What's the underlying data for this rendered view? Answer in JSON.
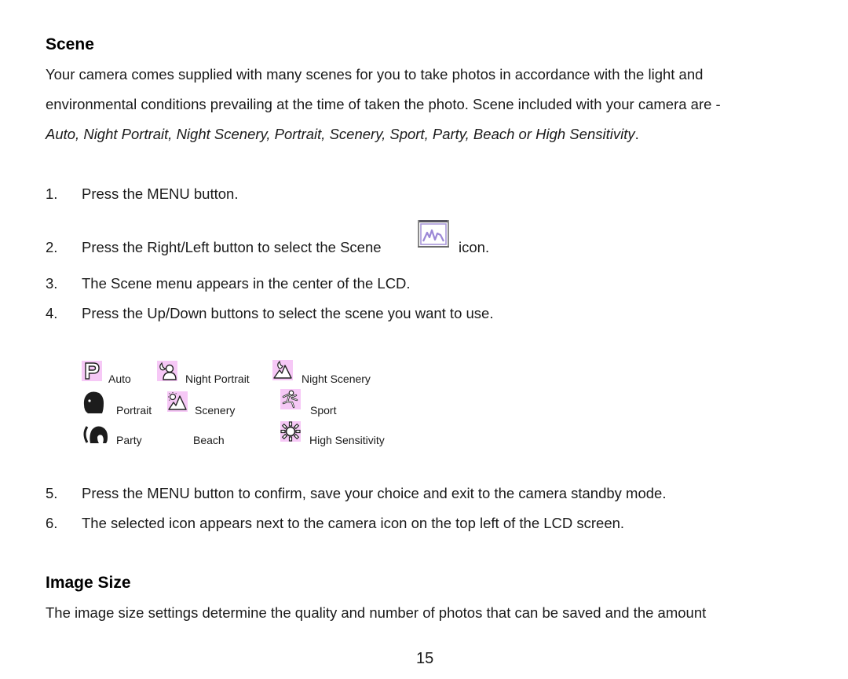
{
  "section1": {
    "heading": "Scene",
    "intro_lines": [
      "Your camera comes supplied with many scenes for you to take photos in accordance with the light and",
      "environmental conditions prevailing at the time of taken the photo. Scene included with your camera are -"
    ],
    "intro_italic": "Auto, Night Portrait, Night Scenery, Portrait, Scenery, Sport, Party, Beach or High Sensitivity",
    "intro_italic_end": ".",
    "steps": [
      {
        "num": "1.",
        "text": "Press the MENU button."
      },
      {
        "num": "2.",
        "text": "Press the Right/Left button to select the Scene",
        "text_after": "icon.",
        "icon": "scene-mode-icon"
      },
      {
        "num": "3.",
        "text": "The Scene menu appears in the center of the LCD."
      },
      {
        "num": "4.",
        "text": "Press the Up/Down buttons to select the scene you want to use."
      },
      {
        "num": "5.",
        "text": "Press the MENU button to confirm, save your choice and exit to the camera standby mode."
      },
      {
        "num": "6.",
        "text": "The selected icon appears next to the camera icon on the top left of the LCD screen."
      }
    ],
    "scene_icons": [
      {
        "label": "Auto",
        "icon": "auto-p-icon"
      },
      {
        "label": "Night Portrait",
        "icon": "night-portrait-icon"
      },
      {
        "label": "Night Scenery",
        "icon": "night-scenery-icon"
      },
      {
        "label": "Portrait",
        "icon": "portrait-icon"
      },
      {
        "label": "Scenery",
        "icon": "scenery-icon"
      },
      {
        "label": "Sport",
        "icon": "sport-icon"
      },
      {
        "label": "Party",
        "icon": "party-icon"
      },
      {
        "label": "Beach",
        "icon": "beach-icon"
      },
      {
        "label": "High Sensitivity",
        "icon": "high-sensitivity-icon"
      }
    ]
  },
  "section2": {
    "heading": "Image Size",
    "intro_line": "The image size settings determine the quality and number of photos that can be saved and the amount"
  },
  "page_number": "15",
  "colors": {
    "icon_bg": "#f6c8f6",
    "scene_icon_border": "#8a7fb3"
  }
}
